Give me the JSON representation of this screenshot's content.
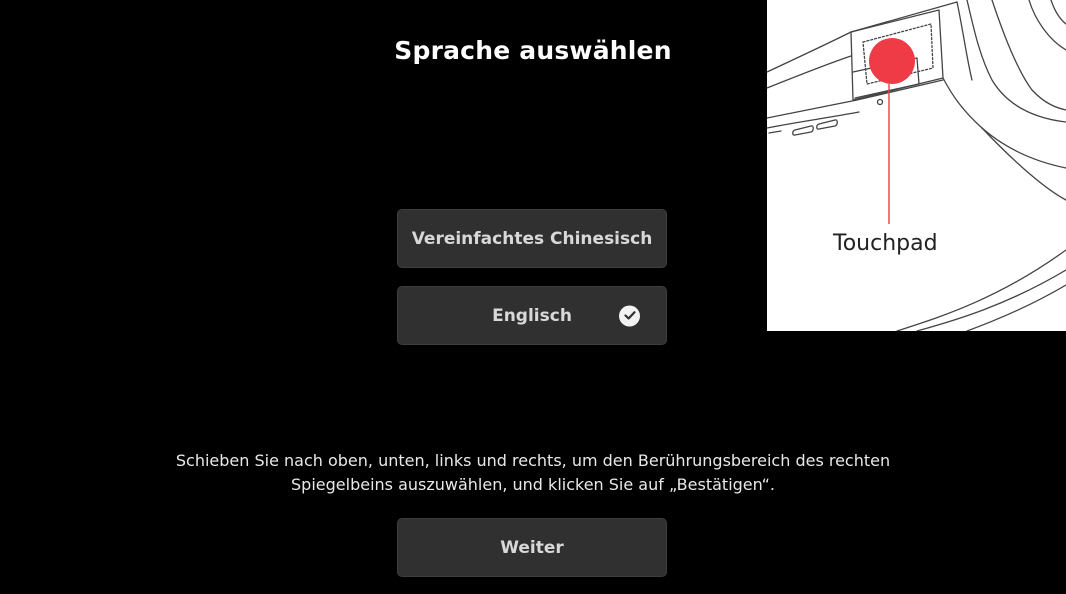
{
  "screen": {
    "title": "Sprache auswählen"
  },
  "languages": {
    "items": [
      {
        "label": "Vereinfachtes Chinesisch",
        "selected": false
      },
      {
        "label": "Englisch",
        "selected": true
      }
    ]
  },
  "instruction": {
    "line1": "Schieben Sie nach oben, unten, links und rechts, um den Berührungsbereich des rechten",
    "line2": "Spiegelbeins auszuwählen, und klicken Sie auf „Bestätigen“."
  },
  "actions": {
    "next_label": "Weiter"
  },
  "illustration": {
    "label": "Touchpad",
    "highlight_color": "#ef3b45",
    "icons": [
      "glasses-illustration",
      "touchpad-highlight"
    ]
  },
  "colors": {
    "background": "#000000",
    "button_bg": "#303030",
    "accent_check": "#f2f2f2"
  }
}
